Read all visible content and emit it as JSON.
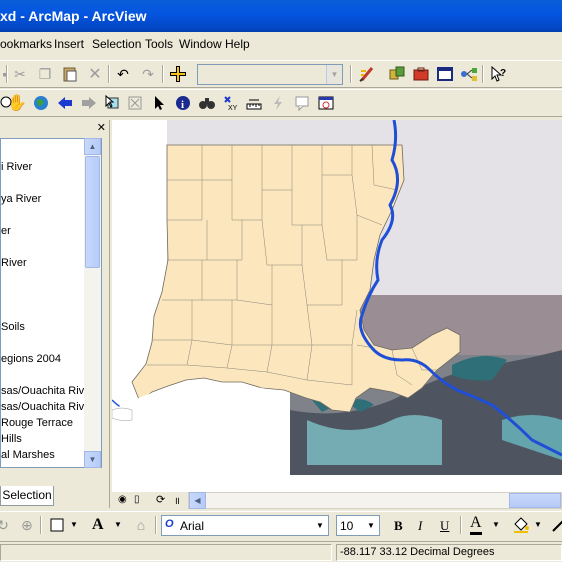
{
  "window": {
    "title": "xd - ArcMap - ArcView"
  },
  "menu": [
    "ookmarks",
    "Insert",
    "Selection",
    "Tools",
    "Window",
    "Help"
  ],
  "toc": {
    "items": [
      "i River",
      "ya River",
      "er",
      "River",
      "Soils",
      "egions 2004",
      "sas/Ouachita Rive",
      "sas/Ouachita Rive",
      "Rouge Terrace",
      "Hills",
      "al Marshes"
    ],
    "tab_label": "Selection"
  },
  "draw_toolbar": {
    "font_name": "Arial",
    "font_size": "10",
    "bold": "B",
    "italic": "I",
    "underline": "U",
    "font_color": "A",
    "text_tool": "A"
  },
  "status": {
    "coordinates": "-88.117  33.12 Decimal Degrees"
  },
  "colors": {
    "title_bar": "#0456e0",
    "state_fill": "#fbe6be",
    "river": "#1f4fd6",
    "marsh": "#2e6f78"
  }
}
